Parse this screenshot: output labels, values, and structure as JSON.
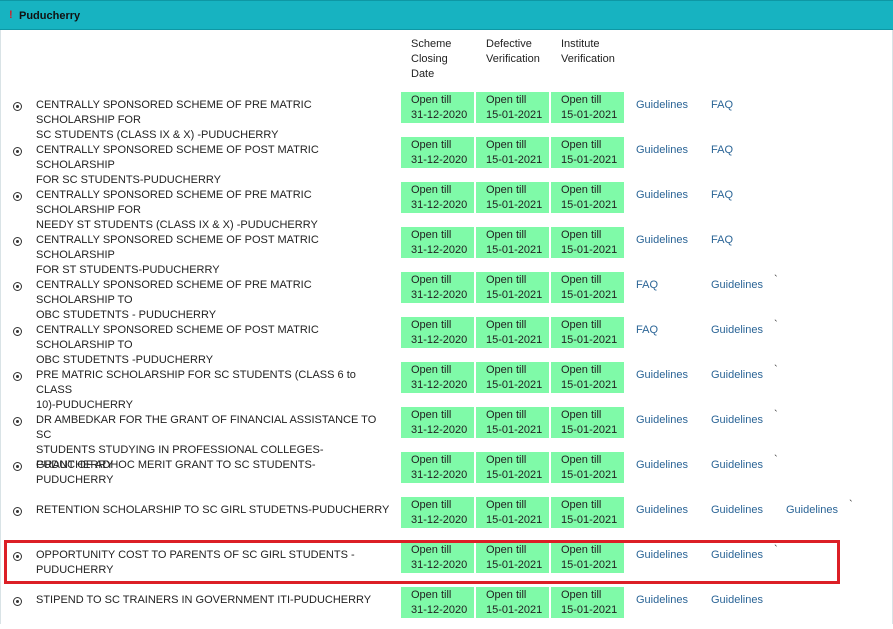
{
  "header": {
    "marker": "!",
    "title": "Puducherry"
  },
  "columns": {
    "closing": [
      "Scheme",
      "Closing",
      "Date"
    ],
    "defective": [
      "Defective",
      "Verification"
    ],
    "institute": [
      "Institute",
      "Verification"
    ]
  },
  "rows": [
    {
      "name1": "CENTRALLY SPONSORED SCHEME OF PRE MATRIC SCHOLARSHIP FOR",
      "name2": "SC STUDENTS (CLASS IX & X) -PUDUCHERRY",
      "c1a": "Open till",
      "c1b": "31-12-2020",
      "c2a": "Open till",
      "c2b": "15-01-2021",
      "c3a": "Open till",
      "c3b": "15-01-2021",
      "links": [
        "Guidelines",
        "FAQ"
      ],
      "tick": ""
    },
    {
      "name1": "CENTRALLY SPONSORED SCHEME OF POST MATRIC SCHOLARSHIP",
      "name2": "FOR SC STUDENTS-PUDUCHERRY",
      "c1a": "Open till",
      "c1b": "31-12-2020",
      "c2a": "Open till",
      "c2b": "15-01-2021",
      "c3a": "Open till",
      "c3b": "15-01-2021",
      "links": [
        "Guidelines",
        "FAQ"
      ],
      "tick": ""
    },
    {
      "name1": "CENTRALLY SPONSORED SCHEME OF PRE MATRIC SCHOLARSHIP FOR",
      "name2": "NEEDY ST STUDENTS (CLASS IX & X) -PUDUCHERRY",
      "c1a": "Open till",
      "c1b": "31-12-2020",
      "c2a": "Open till",
      "c2b": "15-01-2021",
      "c3a": "Open till",
      "c3b": "15-01-2021",
      "links": [
        "Guidelines",
        "FAQ"
      ],
      "tick": ""
    },
    {
      "name1": "CENTRALLY SPONSORED SCHEME OF POST MATRIC SCHOLARSHIP",
      "name2": "FOR ST STUDENTS-PUDUCHERRY",
      "c1a": "Open till",
      "c1b": "31-12-2020",
      "c2a": "Open till",
      "c2b": "15-01-2021",
      "c3a": "Open till",
      "c3b": "15-01-2021",
      "links": [
        "Guidelines",
        "FAQ"
      ],
      "tick": ""
    },
    {
      "name1": "CENTRALLY SPONSORED SCHEME OF PRE MATRIC SCHOLARSHIP TO",
      "name2": "OBC STUDETNTS - PUDUCHERRY",
      "c1a": "Open till",
      "c1b": "31-12-2020",
      "c2a": "Open till",
      "c2b": "15-01-2021",
      "c3a": "Open till",
      "c3b": "15-01-2021",
      "links": [
        "FAQ",
        "Guidelines"
      ],
      "tick": "`"
    },
    {
      "name1": "CENTRALLY SPONSORED SCHEME OF POST MATRIC SCHOLARSHIP TO",
      "name2": "OBC STUDETNTS -PUDUCHERRY",
      "c1a": "Open till",
      "c1b": "31-12-2020",
      "c2a": "Open till",
      "c2b": "15-01-2021",
      "c3a": "Open till",
      "c3b": "15-01-2021",
      "links": [
        "FAQ",
        "Guidelines"
      ],
      "tick": "`"
    },
    {
      "name1": "PRE MATRIC SCHOLARSHIP FOR SC STUDENTS (CLASS 6 to CLASS",
      "name2": "10)-PUDUCHERRY",
      "c1a": "Open till",
      "c1b": "31-12-2020",
      "c2a": "Open till",
      "c2b": "15-01-2021",
      "c3a": "Open till",
      "c3b": "15-01-2021",
      "links": [
        "Guidelines",
        "Guidelines"
      ],
      "tick": "`"
    },
    {
      "name1": "DR AMBEDKAR FOR THE GRANT OF FINANCIAL ASSISTANCE TO SC",
      "name2": "STUDENTS STUDYING IN PROFESSIONAL COLLEGES-PUDUCHERRY",
      "c1a": "Open till",
      "c1b": "31-12-2020",
      "c2a": "Open till",
      "c2b": "15-01-2021",
      "c3a": "Open till",
      "c3b": "15-01-2021",
      "links": [
        "Guidelines",
        "Guidelines"
      ],
      "tick": "`"
    },
    {
      "name1": "GRANT OF ADHOC MERIT GRANT TO SC STUDENTS-PUDUCHERRY",
      "name2": "",
      "c1a": "Open till",
      "c1b": "31-12-2020",
      "c2a": "Open till",
      "c2b": "15-01-2021",
      "c3a": "Open till",
      "c3b": "15-01-2021",
      "links": [
        "Guidelines",
        "Guidelines"
      ],
      "tick": "`"
    },
    {
      "name1": "RETENTION SCHOLARSHIP TO SC GIRL STUDETNS-PUDUCHERRY",
      "name2": "",
      "c1a": "Open till",
      "c1b": "31-12-2020",
      "c2a": "Open till",
      "c2b": "15-01-2021",
      "c3a": "Open till",
      "c3b": "15-01-2021",
      "links": [
        "Guidelines",
        "Guidelines",
        "Guidelines"
      ],
      "tick": "`"
    },
    {
      "name1": "OPPORTUNITY COST TO PARENTS OF SC GIRL STUDENTS -",
      "name2": "PUDUCHERRY",
      "c1a": "Open till",
      "c1b": "31-12-2020",
      "c2a": "Open till",
      "c2b": "15-01-2021",
      "c3a": "Open till",
      "c3b": "15-01-2021",
      "links": [
        "Guidelines",
        "Guidelines"
      ],
      "tick": "`"
    },
    {
      "name1": "STIPEND TO SC TRAINERS IN GOVERNMENT ITI-PUDUCHERRY",
      "name2": "",
      "c1a": "Open till",
      "c1b": "31-12-2020",
      "c2a": "Open till",
      "c2b": "15-01-2021",
      "c3a": "Open till",
      "c3b": "15-01-2021",
      "links": [
        "Guidelines",
        "Guidelines"
      ],
      "tick": ""
    }
  ],
  "colors": {
    "header": "#17b3c1",
    "open_cell": "#7ffaa8",
    "link": "#2a6496",
    "highlight": "#dc1f26"
  }
}
